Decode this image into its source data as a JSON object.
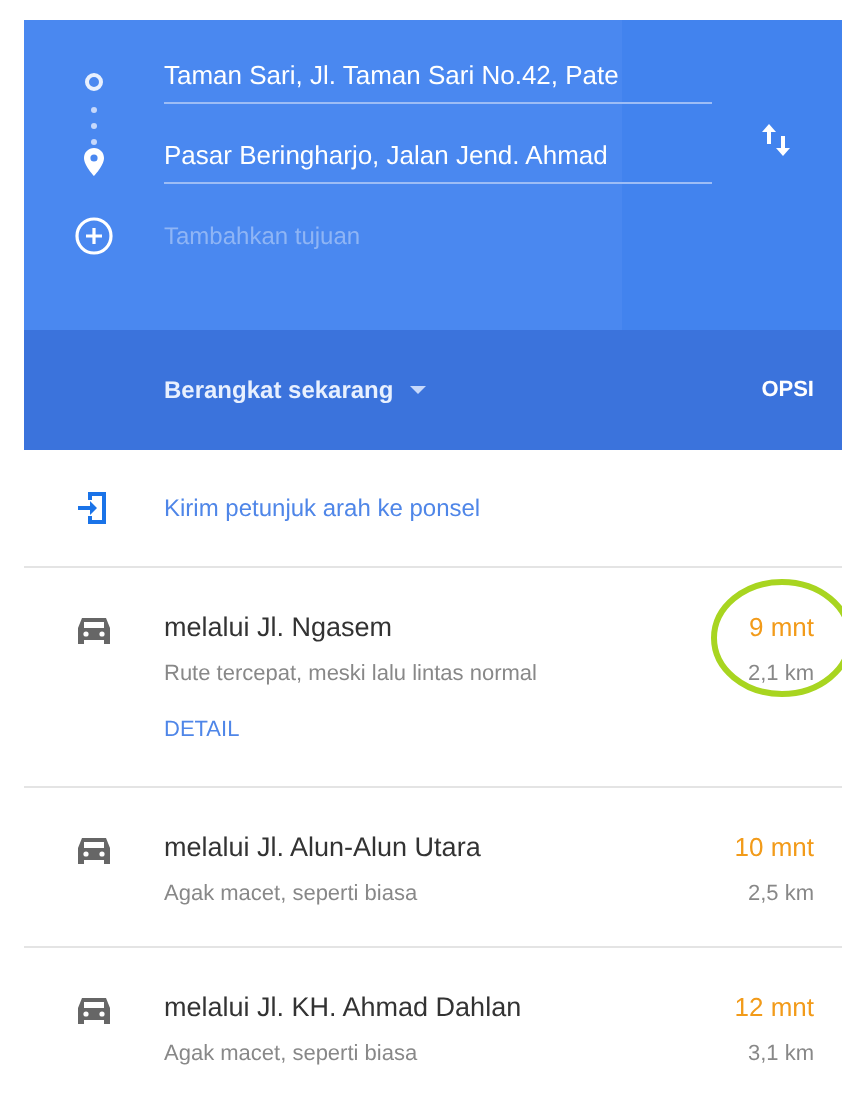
{
  "directions": {
    "origin": "Taman Sari, Jl. Taman Sari No.42, Pate",
    "destination": "Pasar Beringharjo, Jalan Jend. Ahmad",
    "add_stop": {
      "placeholder": "Tambahkan tujuan"
    }
  },
  "depart": {
    "label": "Berangkat sekarang",
    "options": "OPSI"
  },
  "send_to_phone": "Kirim petunjuk arah ke ponsel",
  "routes": [
    {
      "name": "melalui Jl. Ngasem",
      "note": "Rute tercepat, meski lalu lintas normal",
      "time": "9 mnt",
      "distance": "2,1 km",
      "detail": "DETAIL",
      "highlighted": true
    },
    {
      "name": "melalui Jl. Alun-Alun Utara",
      "note": "Agak macet, seperti biasa",
      "time": "10 mnt",
      "distance": "2,5 km",
      "highlighted": false
    },
    {
      "name": "melalui Jl. KH. Ahmad Dahlan",
      "note": "Agak macet, seperti biasa",
      "time": "12 mnt",
      "distance": "3,1 km",
      "highlighted": false
    }
  ]
}
